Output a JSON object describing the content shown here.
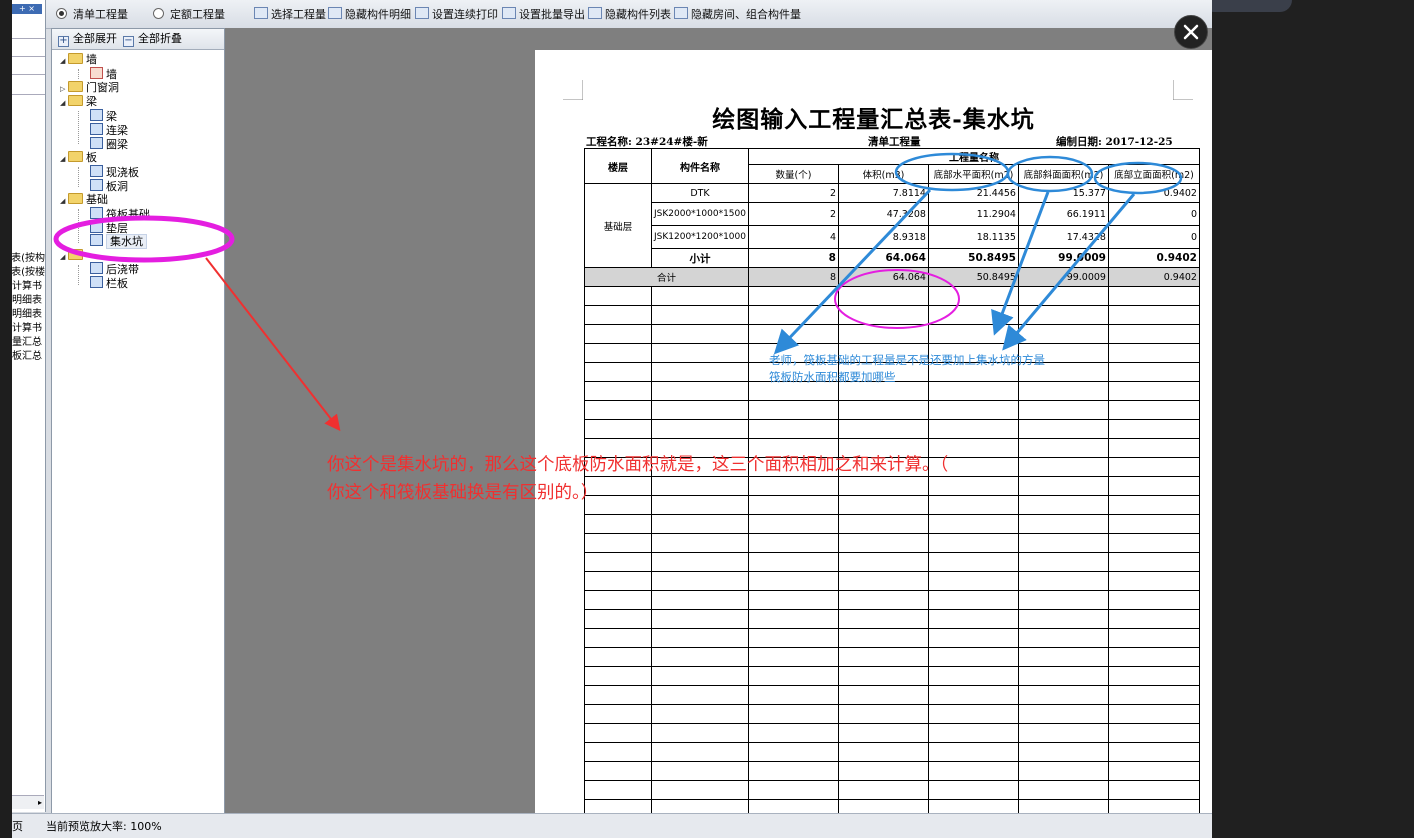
{
  "toolbar": {
    "radio_bill": "清单工程量",
    "radio_quota": "定额工程量",
    "items": [
      "选择工程量",
      "隐藏构件明细",
      "设置连续打印",
      "设置批量导出",
      "隐藏构件列表",
      "隐藏房间、组合构件量"
    ]
  },
  "left_strip": {
    "btn": "+ ×",
    "lines": [
      "表(按构",
      "表(按楼",
      "计算书",
      "明细表",
      "明细表",
      "计算书",
      "量汇总",
      "板汇总"
    ]
  },
  "tree": {
    "expand_all": "全部展开",
    "collapse_all": "全部折叠",
    "wall": "墙",
    "wall_child": "墙",
    "door_window": "门窗洞",
    "beam": "梁",
    "beam_children": [
      "梁",
      "连梁",
      "圈梁"
    ],
    "slab": "板",
    "slab_children": [
      "现浇板",
      "板洞"
    ],
    "foundation": "基础",
    "foundation_children": [
      "筏板基础",
      "垫层",
      "集水坑"
    ],
    "other_children": [
      "后浇带",
      "栏板"
    ]
  },
  "report": {
    "title": "绘图输入工程量汇总表-集水坑",
    "project": "工程名称: 23#24#楼-新",
    "type": "清单工程量",
    "date": "编制日期: 2017-12-25",
    "headers": {
      "floor": "楼层",
      "component": "构件名称",
      "group": "工程量名称",
      "cols": [
        "数量(个)",
        "体积(m3)",
        "底部水平面积(m2)",
        "底部斜面面积(m2)",
        "底部立面面积(m2)"
      ]
    },
    "floor_name": "基础层",
    "rows": [
      {
        "name": "DTK",
        "vals": [
          "2",
          "7.8114",
          "21.4456",
          "15.377",
          "0.9402"
        ]
      },
      {
        "name": "JSK2000*1000*1500",
        "vals": [
          "2",
          "47.3208",
          "11.2904",
          "66.1911",
          "0"
        ]
      },
      {
        "name": "JSK1200*1200*1000",
        "vals": [
          "4",
          "8.9318",
          "18.1135",
          "17.4328",
          "0"
        ]
      }
    ],
    "subtotal_label": "小计",
    "subtotal": [
      "8",
      "64.064",
      "50.8495",
      "99.0009",
      "0.9402"
    ],
    "total_label": "合计",
    "total": [
      "8",
      "64.064",
      "50.8495",
      "99.0009",
      "0.9402"
    ]
  },
  "annotations": {
    "blue_line1": "老师，筏板基础的工程量是不是还要加上集水坑的方量",
    "blue_line2": "筏板防水面积都要加哪些",
    "red_line1": "你这个是集水坑的，那么这个底板防水面积就是，这三个面积相加之和来计算。（",
    "red_line2": "你这个和筏板基础换是有区别的。）"
  },
  "status": {
    "page": "页",
    "zoom": "当前预览放大率: 100%"
  },
  "colors": {
    "blue": "#2e8ad8",
    "magenta": "#e41ee0",
    "red": "#f03030"
  }
}
